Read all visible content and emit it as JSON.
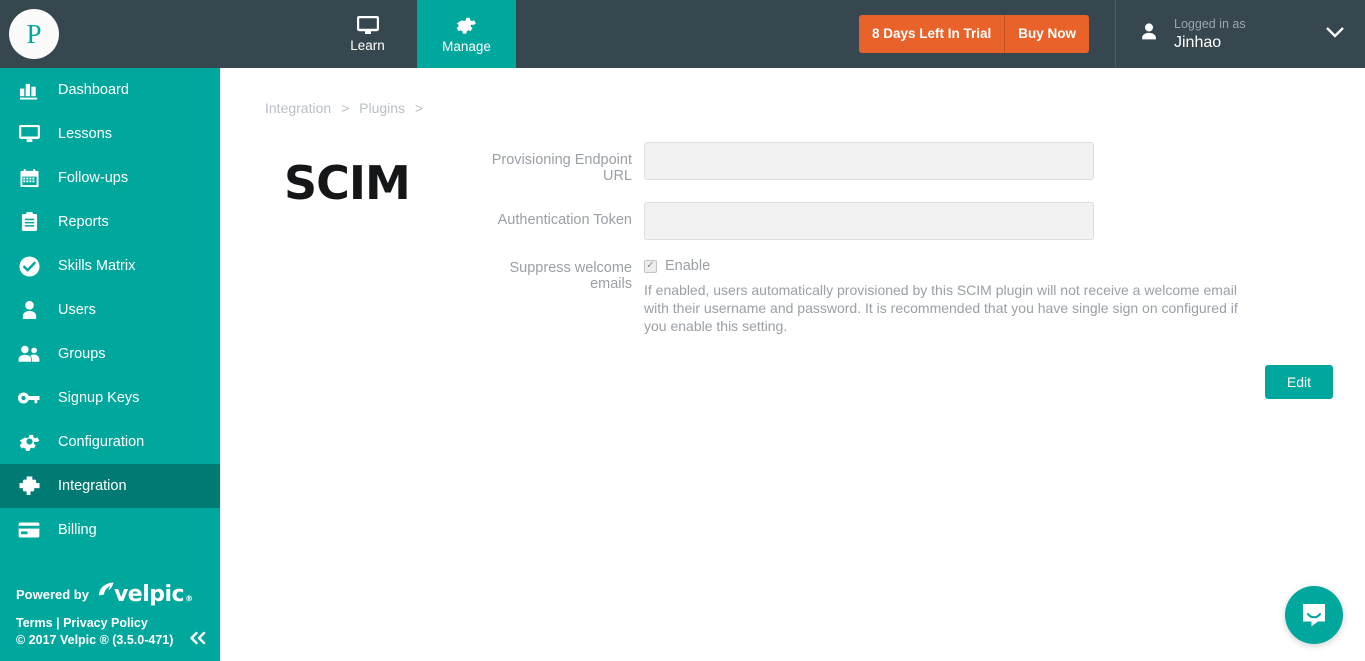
{
  "brand": {
    "logo_letter": "P",
    "logo_name": "p-avatar"
  },
  "header": {
    "tabs": [
      {
        "label": "Learn",
        "icon": "monitor-icon",
        "active": false
      },
      {
        "label": "Manage",
        "icon": "gear-icon",
        "active": true
      }
    ],
    "trial": {
      "days_label": "8 Days Left In Trial",
      "buy_label": "Buy Now"
    },
    "user": {
      "sub_label": "Logged in as",
      "name": "Jinhao",
      "icon": "person-icon",
      "caret": "chevron-down-icon"
    }
  },
  "sidebar": {
    "items": [
      {
        "label": "Dashboard",
        "icon": "bar-chart-icon",
        "active": false
      },
      {
        "label": "Lessons",
        "icon": "monitor-icon",
        "active": false
      },
      {
        "label": "Follow-ups",
        "icon": "calendar-icon",
        "active": false
      },
      {
        "label": "Reports",
        "icon": "clipboard-icon",
        "active": false
      },
      {
        "label": "Skills Matrix",
        "icon": "check-circle-icon",
        "active": false
      },
      {
        "label": "Users",
        "icon": "person-icon",
        "active": false
      },
      {
        "label": "Groups",
        "icon": "people-icon",
        "active": false
      },
      {
        "label": "Signup Keys",
        "icon": "key-icon",
        "active": false
      },
      {
        "label": "Configuration",
        "icon": "gear-icon",
        "active": false
      },
      {
        "label": "Integration",
        "icon": "puzzle-icon",
        "active": true
      },
      {
        "label": "Billing",
        "icon": "credit-card-icon",
        "active": false
      }
    ],
    "footer": {
      "powered_by": "Powered by",
      "brand_word": "velpic",
      "brand_reg": "®",
      "terms": "Terms",
      "separator": "|",
      "privacy": "Privacy Policy",
      "copyright": "© 2017 Velpic ® (3.5.0-471)",
      "collapse_icon": "double-chevron-left-icon"
    }
  },
  "main": {
    "breadcrumb": [
      {
        "label": "Integration",
        "sep": ">"
      },
      {
        "label": "Plugins",
        "sep": ">"
      }
    ],
    "plugin_logo": "SCIM",
    "form": {
      "endpoint": {
        "label": "Provisioning Endpoint URL",
        "value": "",
        "placeholder": ""
      },
      "token": {
        "label": "Authentication Token",
        "value": "",
        "placeholder": ""
      },
      "suppress": {
        "label": "Suppress welcome emails",
        "checkbox_label": "Enable",
        "checked": true,
        "check_glyph": "✓",
        "help": "If enabled, users automatically provisioned by this SCIM plugin will not receive a welcome email with their username and password. It is recommended that you have single sign on configured if you enable this setting."
      },
      "edit_button": "Edit"
    }
  },
  "intercom": {
    "icon": "chat-bubble-icon"
  },
  "colors": {
    "teal": "#00a79d",
    "teal_dark": "#007a73",
    "header_dark": "#36474f",
    "orange": "#e8622a",
    "muted_text": "#9aa0a6"
  }
}
